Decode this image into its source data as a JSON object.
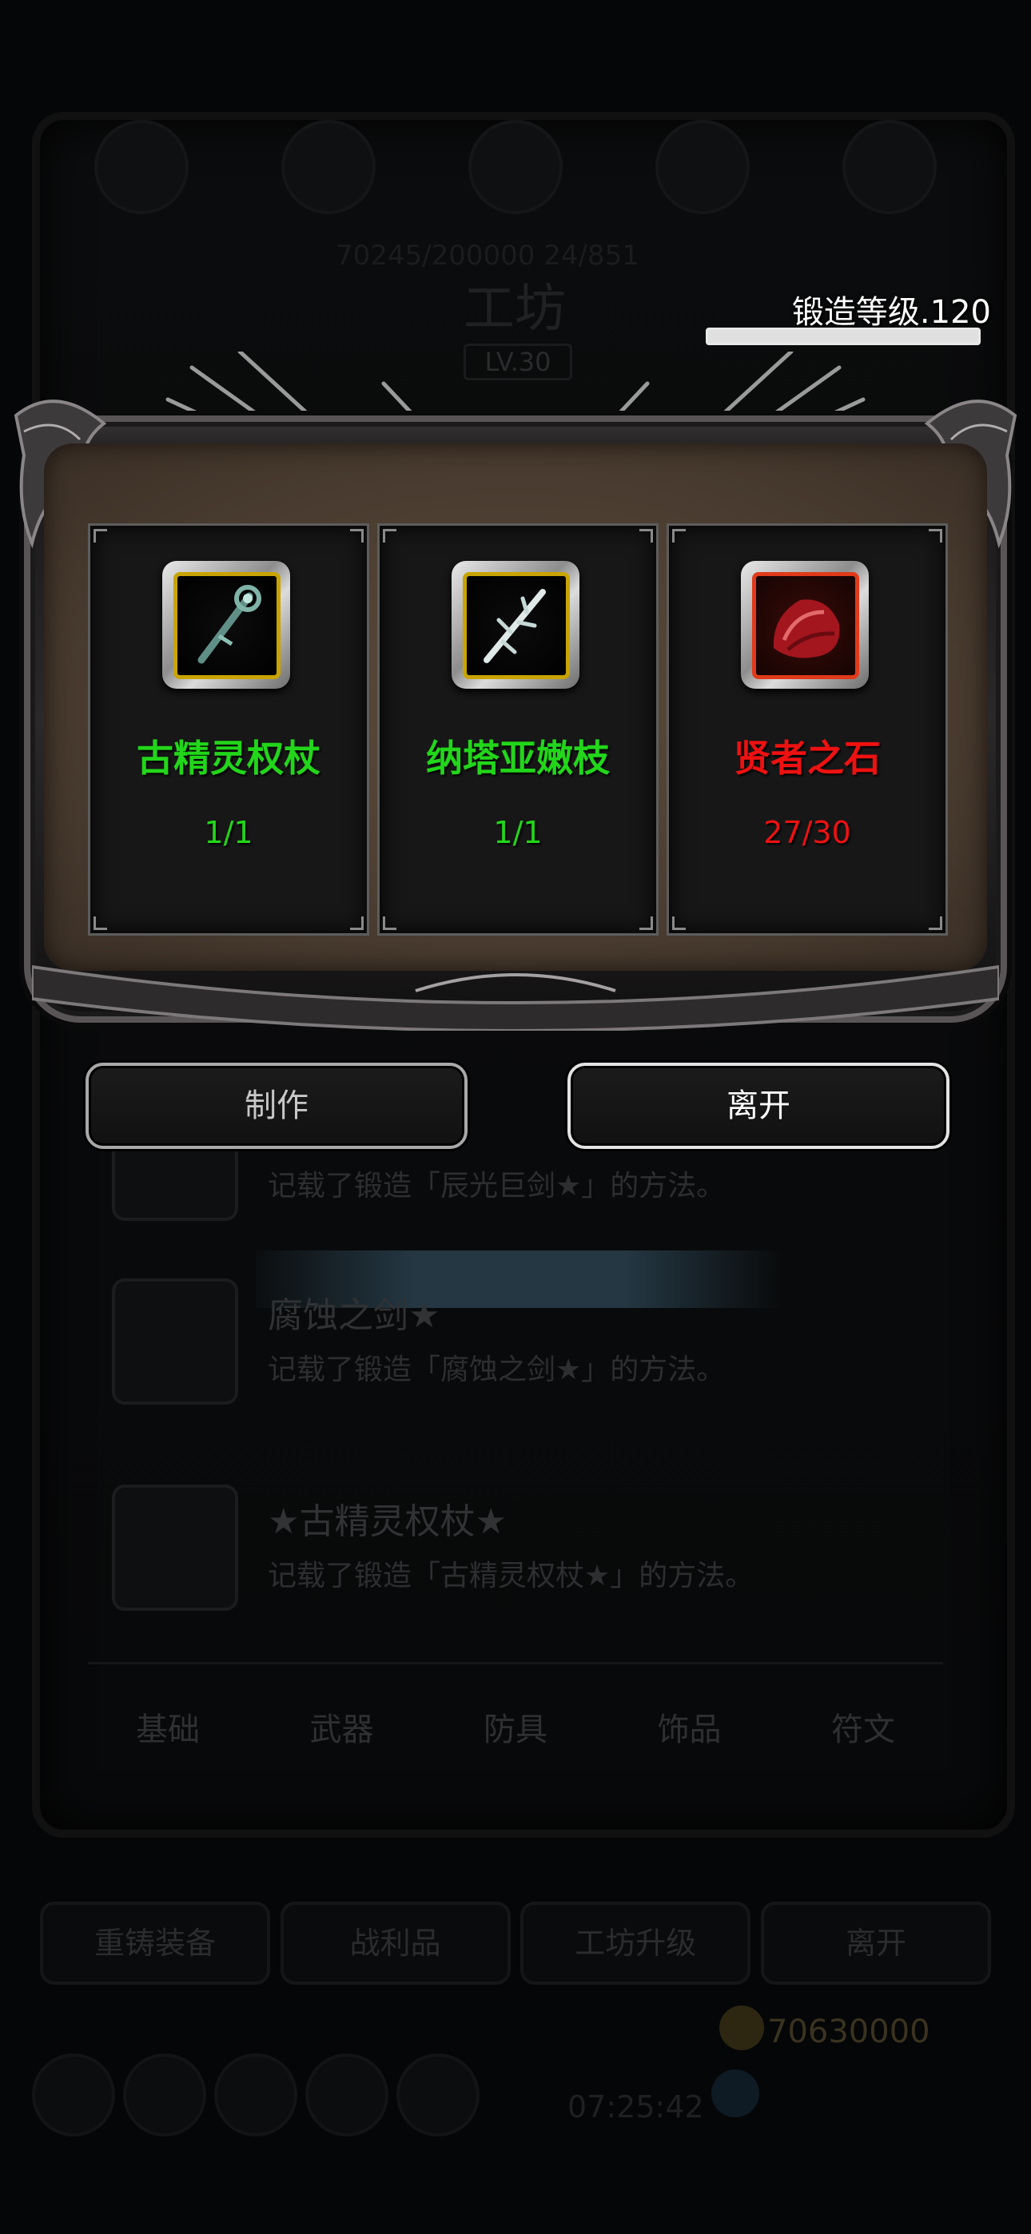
{
  "background": {
    "stats_text": "70245/200000    24/851",
    "workshop_title": "工坊",
    "workshop_level": "LV.30",
    "recipes": [
      {
        "name": "",
        "desc": "记载了锻造「辰光巨剑★」的方法。"
      },
      {
        "name": "腐蚀之剑★",
        "desc": "记载了锻造「腐蚀之剑★」的方法。"
      },
      {
        "name": "★古精灵权杖★",
        "desc": "记载了锻造「古精灵权杖★」的方法。"
      }
    ],
    "tabs": [
      "基础",
      "武器",
      "防具",
      "饰品",
      "符文"
    ],
    "buttons": [
      "重铸装备",
      "战利品",
      "工坊升级",
      "离开"
    ],
    "timer": "07:25:42",
    "gold": "70630000"
  },
  "forge": {
    "level_label": "锻造等级.120",
    "progress": 1.0
  },
  "materials": [
    {
      "name": "古精灵权杖",
      "count": "1/1",
      "icon": "elf-scepter-icon",
      "color": "#22d61a",
      "frame": "gold"
    },
    {
      "name": "纳塔亚嫩枝",
      "count": "1/1",
      "icon": "white-branch-icon",
      "color": "#22d61a",
      "frame": "gold"
    },
    {
      "name": "贤者之石",
      "count": "27/30",
      "icon": "red-stone-icon",
      "color": "#ee1111",
      "frame": "red"
    }
  ],
  "actions": {
    "make_label": "制作",
    "leave_label": "离开"
  }
}
